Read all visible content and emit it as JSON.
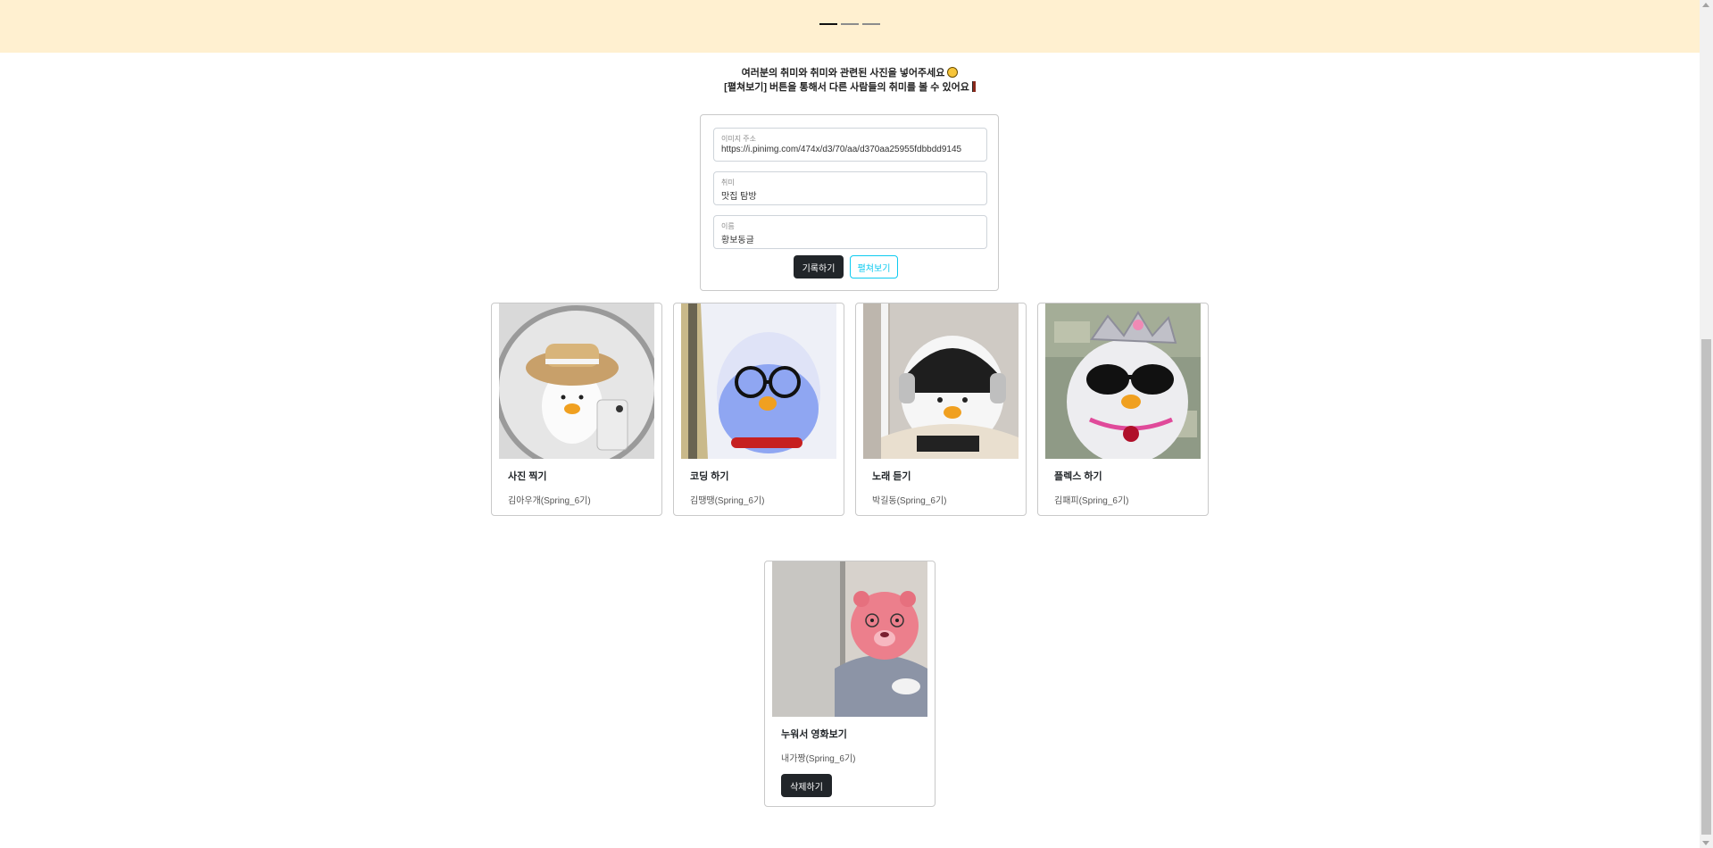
{
  "intro": {
    "line1": "여러분의 취미와 취미와 관련된 사진을 넣어주세요",
    "line2": "[펼쳐보기] 버튼을 통해서 다른 사람들의 취미를 볼 수 있어요"
  },
  "form": {
    "image_label": "이미지 주소",
    "image_value": "https://i.pinimg.com/474x/d3/70/aa/d370aa25955fdbbdd9145",
    "hobby_label": "취미",
    "hobby_value": "맛집 탐방",
    "name_label": "이름",
    "name_value": "황보동글",
    "save_button": "기록하기",
    "open_button": "펼쳐보기"
  },
  "cards": [
    {
      "title": "사진 찍기",
      "name": "김아우개(Spring_6기)",
      "icon": "duck-straw-hat-photo"
    },
    {
      "title": "코딩 하기",
      "name": "김땡땡(Spring_6기)",
      "icon": "duck-glasses-photo"
    },
    {
      "title": "노래 듣기",
      "name": "박길동(Spring_6기)",
      "icon": "duck-headphones-photo"
    },
    {
      "title": "플렉스 하기",
      "name": "김패피(Spring_6기)",
      "icon": "duck-sunglasses-crown-photo"
    },
    {
      "title": "누워서 영화보기",
      "name": "내가짱(Spring_6기)",
      "icon": "pink-beaver-photo",
      "delete_button": "삭제하기"
    }
  ],
  "colors": {
    "banner_bg": "#fff0d0",
    "dark_button": "#212529",
    "info_outline": "#0dcaf0"
  }
}
